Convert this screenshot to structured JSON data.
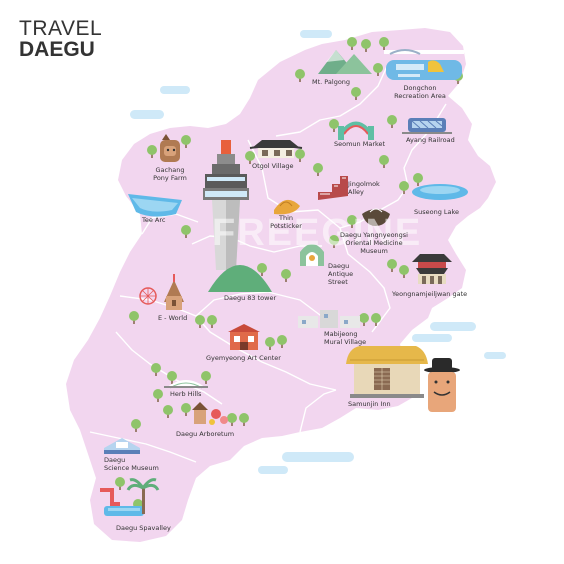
{
  "title": {
    "line1": "TRAVEL",
    "line2": "DAEGU"
  },
  "watermark": "FREEGINE",
  "colors": {
    "land": "#f2d6ef",
    "border": "#ffffff",
    "sky": "#cfe9f8",
    "tree": "#8fc46a",
    "trunk": "#8a6a52"
  },
  "places": [
    {
      "id": "mt-palgong",
      "label": "Mt. Palgong"
    },
    {
      "id": "dongchon",
      "label": "Dongchon\nRecreation Area"
    },
    {
      "id": "seomun-market",
      "label": "Seomun Market"
    },
    {
      "id": "ayang-railroad",
      "label": "Ayang Railroad"
    },
    {
      "id": "gachang",
      "label": "Gachang\nPony Farm"
    },
    {
      "id": "otgol",
      "label": "Otgol Village"
    },
    {
      "id": "jingolmok",
      "label": "Jingolmok\nAlley"
    },
    {
      "id": "tee-arc",
      "label": "Tee Arc"
    },
    {
      "id": "thin-potsticker",
      "label": "Thin\nPotsticker"
    },
    {
      "id": "suseong-lake",
      "label": "Suseong Lake"
    },
    {
      "id": "yangnyeongsi",
      "label": "Daegu Yangnyeongsi\nOriental Medicine\nMuseum"
    },
    {
      "id": "antique-street",
      "label": "Daegu\nAntique\nStreet"
    },
    {
      "id": "yeongnam",
      "label": "Yeongnamjeiljwan gate"
    },
    {
      "id": "83-tower",
      "label": "Daegu 83 tower"
    },
    {
      "id": "e-world",
      "label": "E - World"
    },
    {
      "id": "mabijeong",
      "label": "Mabijeong\nMural Village"
    },
    {
      "id": "gyemyeong",
      "label": "Gyemyeong Art Center"
    },
    {
      "id": "samunjin",
      "label": "Samunjin Inn"
    },
    {
      "id": "herb-hills",
      "label": "Herb Hills"
    },
    {
      "id": "arboretum",
      "label": "Daegu Arboretum"
    },
    {
      "id": "science-museum",
      "label": "Daegu\nScience Museum"
    },
    {
      "id": "spavalley",
      "label": "Daegu Spavalley"
    }
  ]
}
